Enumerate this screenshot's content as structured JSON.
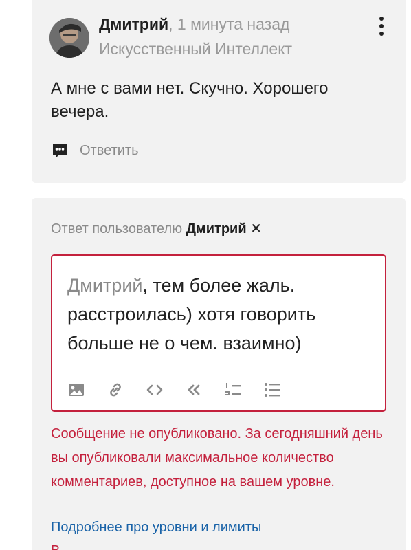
{
  "comment": {
    "author": "Дмитрий",
    "separator": ",",
    "time": "1 минута назад",
    "role": "Искусственный Интеллект",
    "text": "А мне с вами нет. Скучно. Хорошего вечера.",
    "reply_label": "Ответить",
    "icons": {
      "avatar": "user-avatar-photo",
      "more": "more-vertical-icon",
      "reply": "comment-bubble-icon"
    }
  },
  "reply": {
    "reply_to_label": "Ответ пользователю",
    "reply_to_name": "Дмитрий",
    "close_glyph": "✕",
    "editor": {
      "mention": "Дмитрий",
      "text": ", тем более жаль. расстроилась) хотя говорить больше не о чем. взаимно)"
    },
    "toolbar_icons": [
      "image-icon",
      "link-icon",
      "code-icon",
      "quote-icon",
      "ordered-list-icon",
      "bullet-list-icon"
    ],
    "error": "Сообщение не опубликовано. За сегодняшний день вы опубликовали максимальное количество комментариев, доступное на вашем уровне.",
    "limits_link": "Подробнее про уровни и лимиты",
    "cut_text": "В..."
  },
  "colors": {
    "card_background": "#f2f2f2",
    "error_red": "#c4213d",
    "link_blue": "#1a63a8",
    "muted_gray": "#8a8a8a"
  }
}
